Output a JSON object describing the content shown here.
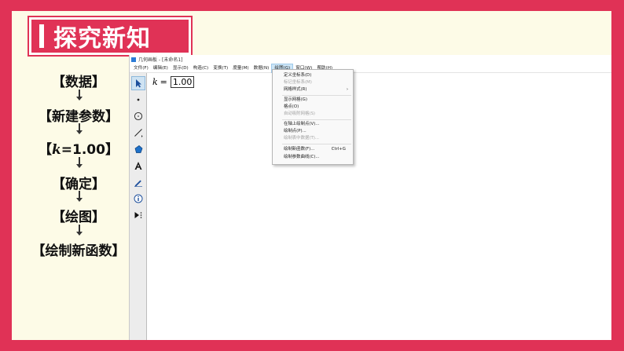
{
  "slide": {
    "title": "探究新知",
    "steps": [
      "【数据】",
      "【新建参数】",
      "【确定】",
      "【绘图】",
      "【绘制新函数】"
    ],
    "param_step": {
      "open": "【",
      "var": "k",
      "rest": "=1.00】"
    }
  },
  "app": {
    "window_title": "几何画板 - [未命名1]",
    "menus": [
      "文件(F)",
      "编辑(E)",
      "显示(D)",
      "构造(C)",
      "变换(T)",
      "度量(M)",
      "数据(N)",
      "绘图(G)",
      "窗口(W)",
      "帮助(H)"
    ],
    "active_menu": "绘图(G)",
    "param_name": "k",
    "param_eq": "=",
    "param_value": "1.00",
    "graph_menu": {
      "define_coords": "定义坐标系(D)",
      "mark_coords": "标记坐标系(M)",
      "grid_style": "网格样式(R)",
      "grid_submenu": "›",
      "show_grid": "显示网格(G)",
      "snap_points": "格点(O)",
      "auto_snap": "自动吸附网格(S)",
      "plot_on_axis": "在轴上绘制点(V)...",
      "plot_points": "绘制点(P)...",
      "plot_table": "绘制表中数据(T)...",
      "plot_function": "绘制新函数(F)...",
      "plot_function_shortcut": "Ctrl+G",
      "plot_parametric": "绘制参数曲线(C)..."
    },
    "tools": [
      "arrow-select-icon",
      "point-icon",
      "circle-compass-icon",
      "line-segment-icon",
      "polygon-icon",
      "text-icon",
      "marker-pen-icon",
      "info-icon",
      "custom-tool-icon"
    ]
  },
  "colors": {
    "accent": "#e03256",
    "slide_bg": "#fdfbe7",
    "menu_highlight": "#cde6f7"
  }
}
